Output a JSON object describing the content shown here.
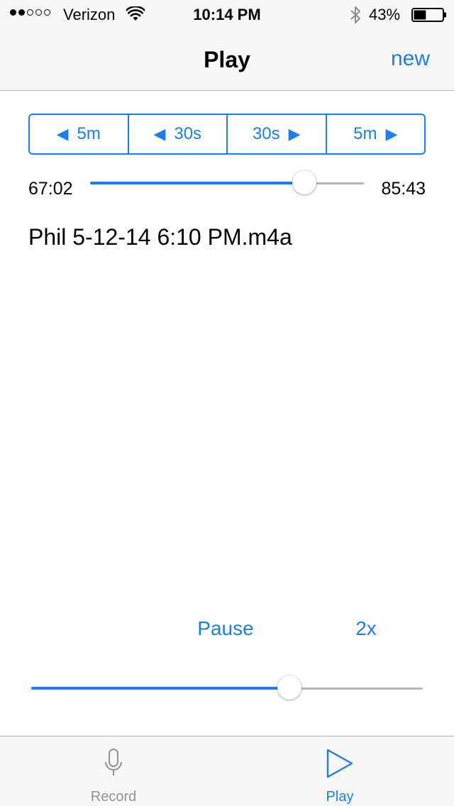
{
  "status_bar": {
    "signal_bars_filled": 2,
    "signal_bars_total": 5,
    "carrier": "Verizon",
    "wifi_icon": "wifi-icon",
    "time": "10:14 PM",
    "bluetooth_icon": "bluetooth-icon",
    "battery_percent": "43%",
    "battery_level": 0.43
  },
  "nav": {
    "title": "Play",
    "new_label": "new"
  },
  "skip_controls": {
    "segments": [
      {
        "label": "5m",
        "icon": "arrow-left-icon",
        "direction": "back"
      },
      {
        "label": "30s",
        "icon": "arrow-left-icon",
        "direction": "back"
      },
      {
        "label": "30s",
        "icon": "arrow-right-icon",
        "direction": "forward"
      },
      {
        "label": "5m",
        "icon": "arrow-right-icon",
        "direction": "forward"
      }
    ]
  },
  "playback": {
    "elapsed": "67:02",
    "total": "85:43",
    "progress_fraction": 0.7821,
    "file_name": "Phil 5-12-14 6:10 PM.m4a"
  },
  "controls": {
    "pause_label": "Pause",
    "speed_label": "2x",
    "speed_slider_fraction": 0.66
  },
  "tab_bar": {
    "tabs": [
      {
        "label": "Record",
        "icon": "microphone-icon",
        "selected": false
      },
      {
        "label": "Play",
        "icon": "play-icon",
        "selected": true
      }
    ]
  },
  "colors": {
    "accent": "#1a7ef2",
    "bar_background": "#f7f7f7",
    "inactive_tab": "#929292",
    "track": "#b6b6b6"
  }
}
